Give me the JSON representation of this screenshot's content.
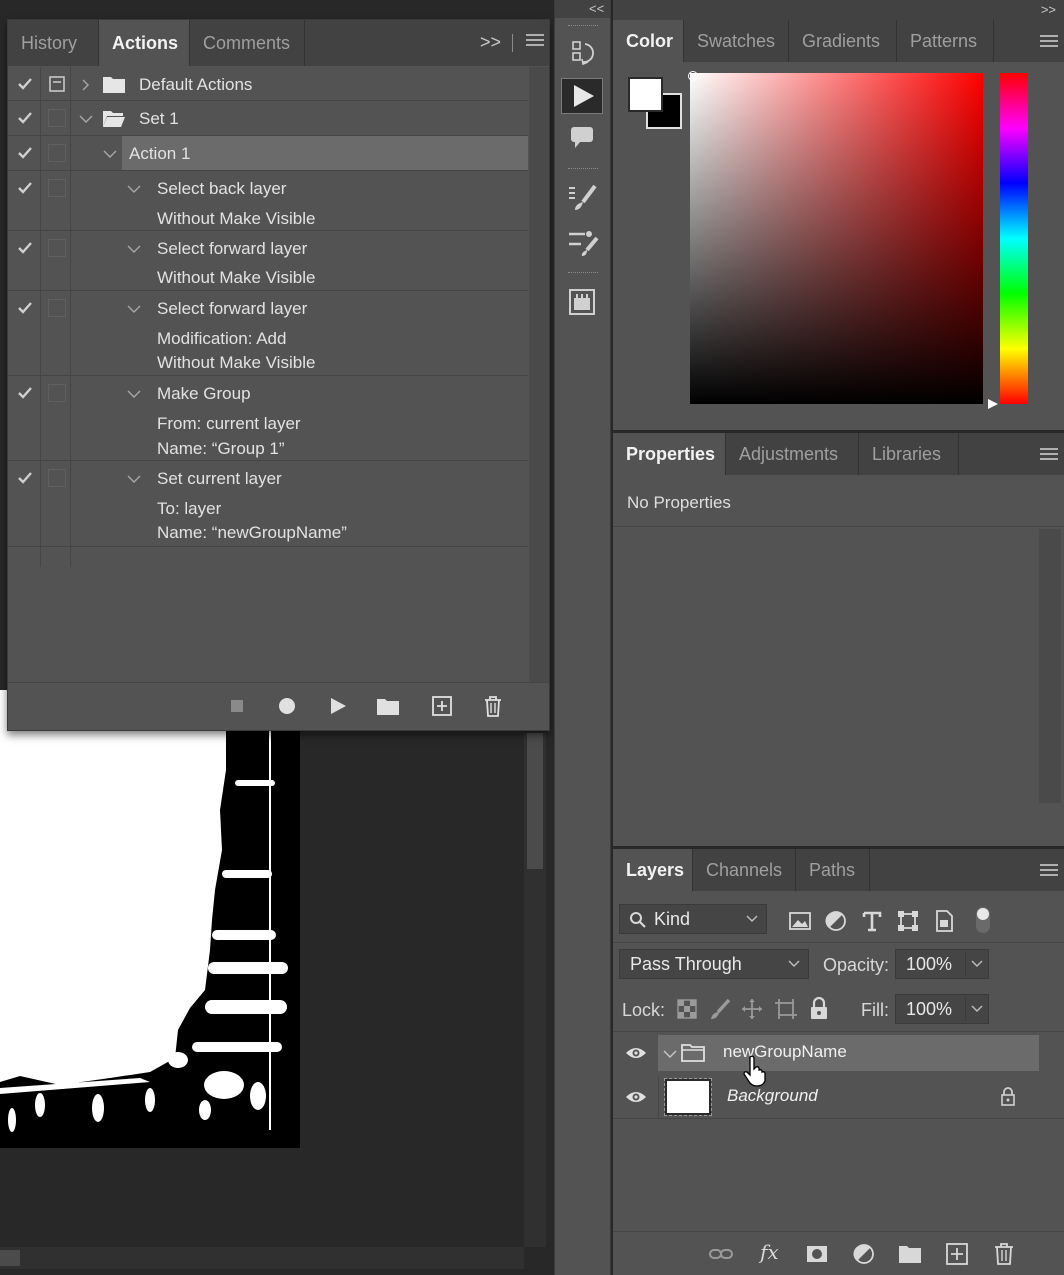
{
  "actions_panel": {
    "tabs": [
      "History",
      "Actions",
      "Comments"
    ],
    "expand_glyph": ">>",
    "rows": [
      {
        "title": "Default Actions"
      },
      {
        "title": "Set 1"
      },
      {
        "title": "Action 1"
      },
      {
        "title": "Select back layer",
        "details": [
          "Without Make Visible"
        ]
      },
      {
        "title": "Select forward layer",
        "details": [
          "Without Make Visible"
        ]
      },
      {
        "title": "Select forward layer",
        "details": [
          "Modification: Add",
          "Without Make Visible"
        ]
      },
      {
        "title": "Make Group",
        "details": [
          "From: current layer",
          "Name:  “Group 1”"
        ]
      },
      {
        "title": "Set current layer",
        "details": [
          "To: layer",
          "Name:  “newGroupName”"
        ]
      }
    ],
    "footer_buttons": [
      "stop-icon",
      "record-icon",
      "play-icon",
      "folder-icon",
      "new-action-icon",
      "trash-icon"
    ]
  },
  "tools_strip": {
    "collapse_glyph": "<<",
    "tools": [
      "history-icon",
      "actions-play-icon",
      "comments-icon",
      "brush-presets-icon",
      "brush-settings-icon",
      "libraries-icon"
    ]
  },
  "right_top": {
    "collapse_glyph": ">>"
  },
  "color_panel": {
    "tabs": [
      "Color",
      "Swatches",
      "Gradients",
      "Patterns"
    ],
    "foreground": "#ffffff",
    "background": "#000000",
    "hue": "#ff0000"
  },
  "properties_panel": {
    "tabs": [
      "Properties",
      "Adjustments",
      "Libraries"
    ],
    "empty_text": "No Properties"
  },
  "layers_panel": {
    "tabs": [
      "Layers",
      "Channels",
      "Paths"
    ],
    "filter_kind": "Kind",
    "blend_mode": "Pass Through",
    "opacity_label": "Opacity:",
    "opacity_value": "100%",
    "lock_label": "Lock:",
    "fill_label": "Fill:",
    "fill_value": "100%",
    "layers": [
      {
        "name": "newGroupName",
        "type": "group",
        "selected": true
      },
      {
        "name": "Background",
        "type": "pixel",
        "locked": true
      }
    ],
    "footer_buttons": [
      "link-icon",
      "fx-icon",
      "mask-icon",
      "adjustment-icon",
      "group-folder-icon",
      "new-layer-icon",
      "delete-icon"
    ],
    "fx_label": "fx"
  }
}
